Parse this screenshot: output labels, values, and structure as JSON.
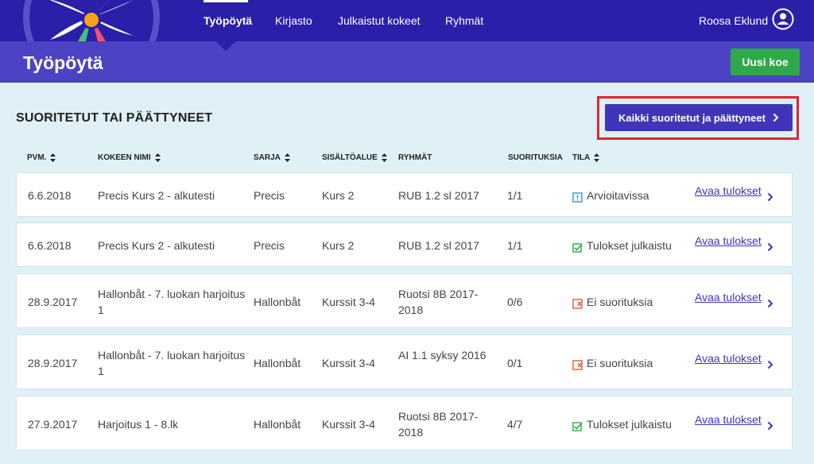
{
  "nav": {
    "items": [
      {
        "label": "Työpöytä",
        "active": true
      },
      {
        "label": "Kirjasto",
        "active": false
      },
      {
        "label": "Julkaistut kokeet",
        "active": false
      },
      {
        "label": "Ryhmät",
        "active": false
      }
    ],
    "user_name": "Roosa Eklund"
  },
  "page": {
    "title": "Työpöytä",
    "new_button_label": "Uusi koe"
  },
  "section": {
    "title": "SUORITETUT TAI PÄÄTTYNEET",
    "all_button_label": "Kaikki suoritetut ja päättyneet"
  },
  "columns": {
    "date": "PVM.",
    "name": "KOKEEN NIMI",
    "series": "SARJA",
    "content": "SISÄLTÖALUE",
    "groups": "RYHMÄT",
    "submissions": "SUORITUKSIA",
    "status": "TILA"
  },
  "rows": [
    {
      "date": "6.6.2018",
      "name": "Precis Kurs 2 - alkutesti",
      "series": "Precis",
      "content": "Kurs 2",
      "groups": "RUB 1.2 sl 2017",
      "submissions": "1/1",
      "status": "Arvioitavissa",
      "status_icon": "exclamation-icon",
      "link": "Avaa tulokset"
    },
    {
      "date": "6.6.2018",
      "name": "Precis Kurs 2 - alkutesti",
      "series": "Precis",
      "content": "Kurs 2",
      "groups": "RUB 1.2 sl 2017",
      "submissions": "1/1",
      "status": "Tulokset julkaistu",
      "status_icon": "check-icon",
      "link": "Avaa tulokset"
    },
    {
      "date": "28.9.2017",
      "name": "Hallonbåt - 7. luokan harjoitus 1",
      "series": "Hallonbåt",
      "content": "Kurssit 3-4",
      "groups": "Ruotsi 8B 2017-2018",
      "submissions": "0/6",
      "status": "Ei suorituksia",
      "status_icon": "cross-icon",
      "link": "Avaa tulokset"
    },
    {
      "date": "28.9.2017",
      "name": "Hallonbåt - 7. luokan harjoitus 1",
      "series": "Hallonbåt",
      "content": "Kurssit 3-4",
      "groups": "AI 1.1 syksy 2016",
      "submissions": "0/1",
      "status": "Ei suorituksia",
      "status_icon": "cross-icon",
      "link": "Avaa tulokset"
    },
    {
      "date": "27.9.2017",
      "name": "Harjoitus 1 - 8.lk",
      "series": "Hallonbåt",
      "content": "Kurssit 3-4",
      "groups": "Ruotsi 8B 2017-2018",
      "submissions": "4/7",
      "status": "Tulokset julkaistu",
      "status_icon": "check-icon",
      "link": "Avaa tulokset"
    }
  ],
  "colors": {
    "nav_bg": "#2a1fa8",
    "header_bg": "#4c43c4",
    "page_bg": "#dff1f7",
    "primary_button": "#3e35b8",
    "new_button": "#2ea84a",
    "highlight": "#e5232e",
    "status_pending": "#3d8fd1",
    "status_published": "#2ea84a",
    "status_none": "#e05a3a"
  }
}
